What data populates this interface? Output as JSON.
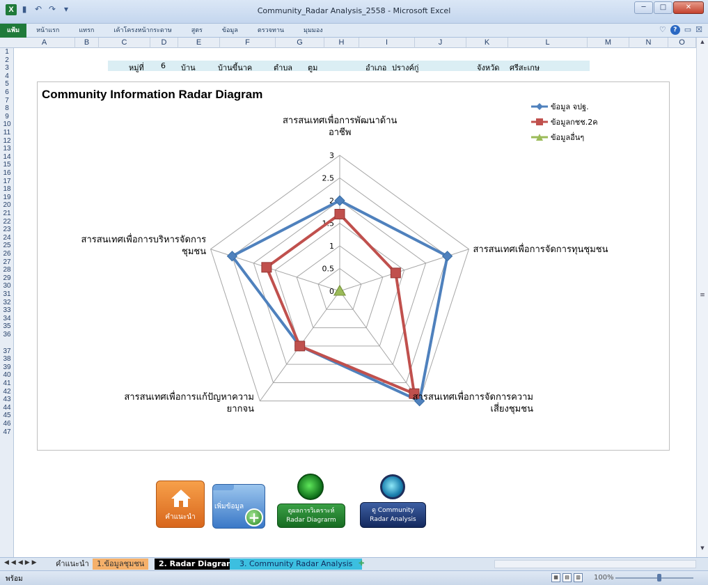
{
  "window": {
    "title": "Community_Radar Analysis_2558 - Microsoft Excel",
    "app_icon_label": "X",
    "qat_icons": [
      "save-icon",
      "undo-icon",
      "redo-icon",
      "customize-icon"
    ],
    "controls": [
      "minimize",
      "maximize",
      "close"
    ]
  },
  "ribbon": {
    "tabs": [
      "แฟ้ม",
      "หน้าแรก",
      "แทรก",
      "เค้าโครงหน้ากระดาษ",
      "สูตร",
      "ข้อมูล",
      "ตรวจทาน",
      "มุมมอง"
    ]
  },
  "columns": [
    "A",
    "B",
    "C",
    "D",
    "E",
    "F",
    "G",
    "H",
    "I",
    "J",
    "K",
    "L",
    "M",
    "N",
    "O"
  ],
  "rows": [
    "1",
    "2",
    "3",
    "4",
    "5",
    "6",
    "7",
    "8",
    "9",
    "10",
    "11",
    "12",
    "13",
    "14",
    "15",
    "16",
    "17",
    "18",
    "19",
    "20",
    "21",
    "22",
    "23",
    "24",
    "25",
    "26",
    "27",
    "28",
    "29",
    "30",
    "31",
    "32",
    "33",
    "34",
    "35",
    "36",
    "37",
    "38",
    "39",
    "40",
    "41",
    "42",
    "43",
    "44",
    "45",
    "46",
    "47"
  ],
  "info": {
    "moo_label": "หมู่ที่",
    "moo_value": "6",
    "village_label": "บ้าน",
    "village_value": "บ้านขี้นาค",
    "tambon_label": "ตำบล",
    "tambon_value": "ตูม",
    "amphoe_label": "อำเภอ",
    "amphoe_value": "ปรางค์กู่",
    "province_label": "จังหวัด",
    "province_value": "ศรีสะเกษ"
  },
  "chart_data": {
    "type": "radar",
    "title": "Community Information Radar Diagram",
    "axes": [
      "สารสนเทศเพื่อการพัฒนาด้านอาชีพ",
      "สารสนเทศเพื่อการจัดการทุนชุมชน",
      "สารสนเทศเพื่อการจัดการความเสี่ยงชุมชน",
      "สารสนเทศเพื่อการแก้ปัญหาความยากจน",
      "สารสนเทศเพื่อการบริหารจัดการชุมชน"
    ],
    "axis_label_lines": [
      [
        "สารสนเทศเพื่อการพัฒนาด้าน",
        "อาชีพ"
      ],
      [
        "สารสนเทศเพื่อการจัดการทุนชุมชน"
      ],
      [
        "สารสนเทศเพื่อการจัดการความ",
        "เสี่ยงชุมชน"
      ],
      [
        "สารสนเทศเพื่อการแก้ปัญหาความ",
        "ยากจน"
      ],
      [
        "สารสนเทศเพื่อการบริหารจัดการ",
        "ชุมชน"
      ]
    ],
    "range": [
      0,
      3
    ],
    "ticks": [
      0,
      0.5,
      1,
      1.5,
      2,
      2.5,
      3
    ],
    "tick_labels": [
      "0",
      "0.5",
      "1",
      "1.5",
      "2",
      "2.5",
      "3"
    ],
    "series": [
      {
        "name": "ข้อมูล จปฐ.",
        "color": "#4f81bd",
        "marker": "diamond",
        "values": [
          2.0,
          2.5,
          3.0,
          1.5,
          2.5
        ]
      },
      {
        "name": "ข้อมูลกชช.2ค",
        "color": "#c0504d",
        "marker": "square",
        "values": [
          1.7,
          1.3,
          2.8,
          1.5,
          1.7
        ]
      },
      {
        "name": "ข้อมูลอื่นๆ",
        "color": "#9bbb59",
        "marker": "triangle",
        "values": [
          0,
          0,
          0,
          0,
          0
        ]
      }
    ],
    "legend_position": "top-right",
    "grid": true
  },
  "buttons": {
    "home_label": "คำแนะนำ",
    "add_data_label": "เพิ่มข้อมูล",
    "view_radar_label_1": "ดูผลการวิเคราะห์",
    "view_radar_label_2": "Radar Diagrarm",
    "community_label_1": "ดู Community",
    "community_label_2": "Radar Analysis"
  },
  "sheet_tabs": [
    "คำแนะนำ",
    "1.ข้อมูลชุมชน",
    "2. Radar Diagram",
    "3. Community Radar Analysis"
  ],
  "status": {
    "ready": "พร้อม",
    "zoom": "100%"
  }
}
